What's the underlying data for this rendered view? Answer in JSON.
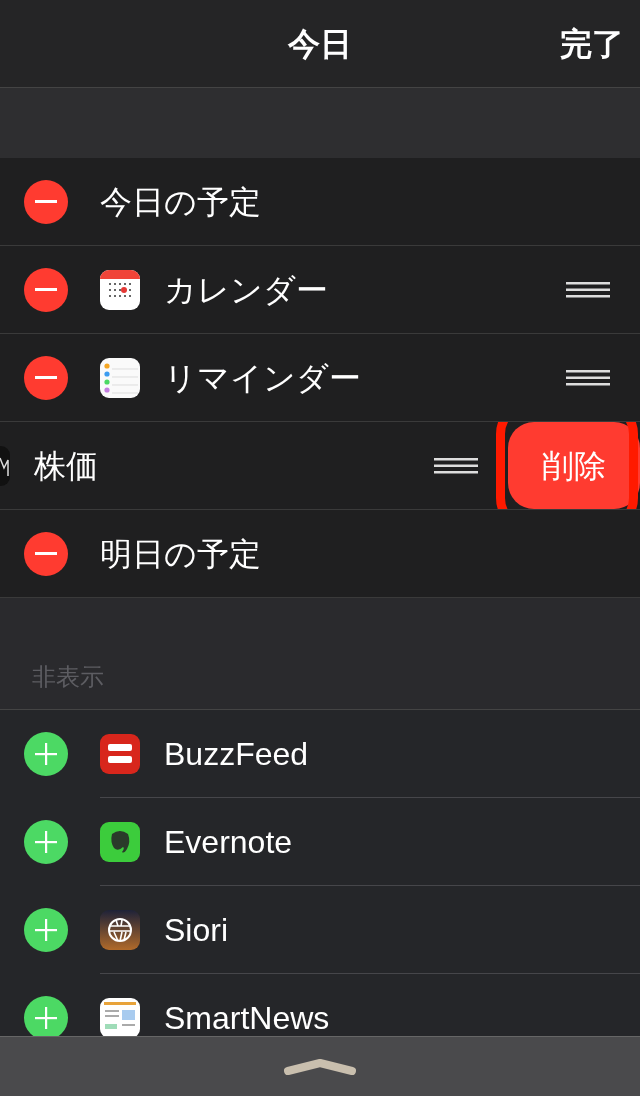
{
  "header": {
    "title": "今日",
    "done": "完了"
  },
  "active_widgets": [
    {
      "label": "今日の予定",
      "kind": "none",
      "reorderable": false,
      "swiped": false
    },
    {
      "label": "カレンダー",
      "kind": "calendar",
      "reorderable": true,
      "swiped": false
    },
    {
      "label": "リマインダー",
      "kind": "reminders",
      "reorderable": true,
      "swiped": false
    },
    {
      "label": "株価",
      "kind": "stocks",
      "reorderable": true,
      "swiped": true,
      "delete_label": "削除",
      "highlighted": true
    },
    {
      "label": "明日の予定",
      "kind": "none",
      "reorderable": false,
      "swiped": false
    }
  ],
  "hidden_section": {
    "title": "非表示",
    "widgets": [
      {
        "label": "BuzzFeed",
        "kind": "buzzfeed"
      },
      {
        "label": "Evernote",
        "kind": "evernote"
      },
      {
        "label": "Siori",
        "kind": "siori"
      },
      {
        "label": "SmartNews",
        "kind": "smartnews"
      }
    ]
  }
}
